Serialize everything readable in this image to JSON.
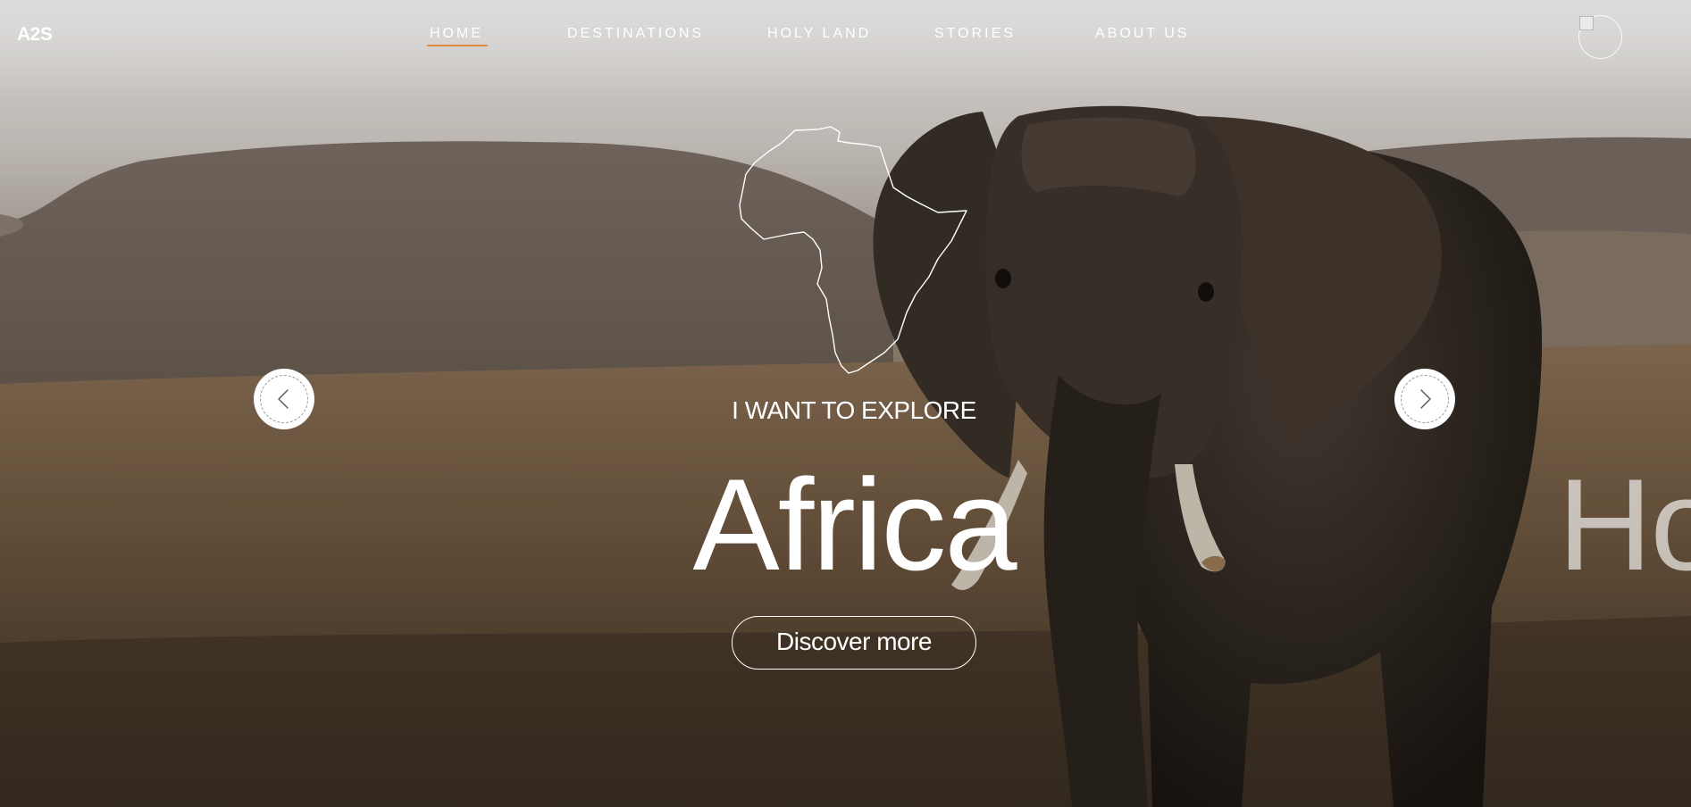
{
  "header": {
    "logo": "A2S",
    "nav": [
      {
        "label": "HOME",
        "active": true
      },
      {
        "label": "DESTINATIONS",
        "active": false
      },
      {
        "label": "HOLY LAND",
        "active": false
      },
      {
        "label": "STORIES",
        "active": false
      },
      {
        "label": "ABOUT US",
        "active": false
      }
    ],
    "avatar_icon": "broken-image-icon"
  },
  "slider": {
    "eyebrow": "I WANT TO EXPLORE",
    "title": "Africa",
    "next_title_peek": "Ho",
    "cta_label": "Discover more",
    "prev_icon": "chevron-left-icon",
    "next_icon": "chevron-right-icon",
    "map_icon": "africa-map-outline-icon"
  },
  "colors": {
    "accent": "#e08a3c",
    "text": "#ffffff"
  }
}
